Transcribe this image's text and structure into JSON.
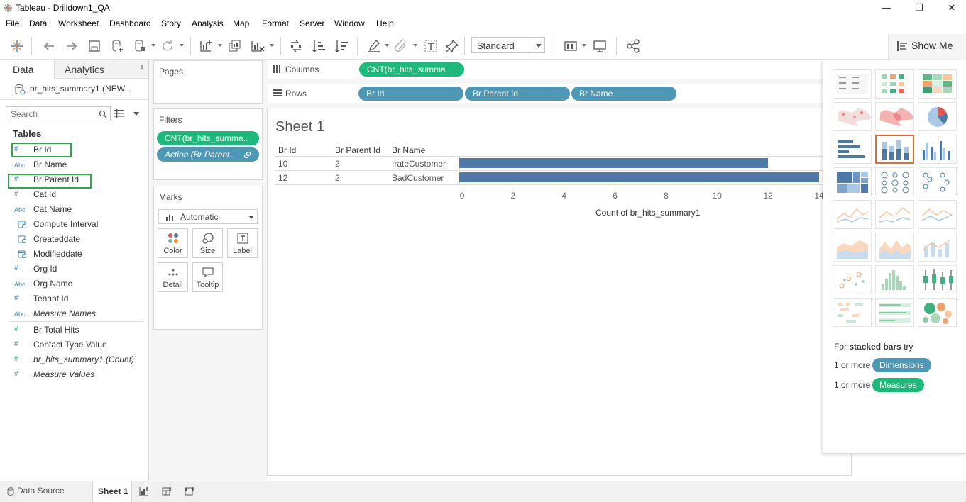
{
  "window": {
    "title": "Tableau - Drilldown1_QA",
    "controls": {
      "minimize": "—",
      "restore": "❐",
      "close": "✕"
    }
  },
  "menu": [
    "File",
    "Data",
    "Worksheet",
    "Dashboard",
    "Story",
    "Analysis",
    "Map",
    "Format",
    "Server",
    "Window",
    "Help"
  ],
  "toolbar": {
    "fit_select": "Standard",
    "show_me_label": "Show Me",
    "icons": [
      "tableau-logo-icon",
      "undo-icon",
      "redo-icon",
      "save-icon",
      "new-datasource-icon",
      "pause-updates-icon",
      "refresh-icon",
      "new-worksheet-icon",
      "duplicate-sheet-icon",
      "clear-sheet-icon",
      "swap-rows-columns-icon",
      "sort-ascending-icon",
      "sort-descending-icon",
      "highlight-icon",
      "group-icon",
      "show-labels-icon",
      "pin-icon",
      "show-cards-icon",
      "presentation-icon",
      "share-icon"
    ]
  },
  "left_pane": {
    "tabs": [
      "Data",
      "Analytics"
    ],
    "active_tab": "Data",
    "datasource": "br_hits_summary1 (NEW...",
    "search_placeholder": "Search",
    "tables_heading": "Tables",
    "dimensions": [
      {
        "type": "#",
        "name": "Br Id",
        "kind": "dim",
        "highlighted": true
      },
      {
        "type": "Abc",
        "name": "Br Name",
        "kind": "dim"
      },
      {
        "type": "#",
        "name": "Br Parent Id",
        "kind": "dim",
        "highlighted": true
      },
      {
        "type": "#",
        "name": "Cat Id",
        "kind": "dim"
      },
      {
        "type": "Abc",
        "name": "Cat Name",
        "kind": "dim"
      },
      {
        "type": "cal",
        "name": "Compute Interval",
        "kind": "dim"
      },
      {
        "type": "cal",
        "name": "Createddate",
        "kind": "dim"
      },
      {
        "type": "cal",
        "name": "Modifieddate",
        "kind": "dim"
      },
      {
        "type": "#",
        "name": "Org Id",
        "kind": "dim"
      },
      {
        "type": "Abc",
        "name": "Org Name",
        "kind": "dim"
      },
      {
        "type": "#",
        "name": "Tenant Id",
        "kind": "dim"
      },
      {
        "type": "Abc",
        "name": "Measure Names",
        "kind": "dim",
        "italic": true
      }
    ],
    "measures": [
      {
        "type": "#",
        "name": "Br Total Hits"
      },
      {
        "type": "#",
        "name": "Contact Type Value"
      },
      {
        "type": "#",
        "name": "br_hits_summary1 (Count)",
        "italic": true
      },
      {
        "type": "#",
        "name": "Measure Values",
        "italic": true
      }
    ]
  },
  "cards": {
    "pages_title": "Pages",
    "filters_title": "Filters",
    "filters": [
      "CNT(br_hits_summa..",
      "Action (Br Parent.."
    ],
    "marks_title": "Marks",
    "mark_type": "Automatic",
    "mark_buttons": [
      "Color",
      "Size",
      "Label",
      "Detail",
      "Tooltip"
    ]
  },
  "shelves": {
    "columns_label": "Columns",
    "columns": [
      "CNT(br_hits_summa.."
    ],
    "rows_label": "Rows",
    "rows": [
      "Br Id",
      "Br Parent Id",
      "Br Name"
    ]
  },
  "sheet": {
    "title": "Sheet 1",
    "headers": [
      "Br Id",
      "Br Parent Id",
      "Br Name"
    ],
    "axis_title": "Count of br_hits_summary1"
  },
  "chart_data": {
    "type": "bar",
    "orientation": "horizontal",
    "title": "",
    "row_headers": [
      "Br Id",
      "Br Parent Id",
      "Br Name"
    ],
    "rows": [
      {
        "br_id": "10",
        "br_parent_id": "2",
        "br_name": "IrateCustomer",
        "value": 12
      },
      {
        "br_id": "12",
        "br_parent_id": "2",
        "br_name": "BadCustomer",
        "value": 14
      }
    ],
    "xlabel": "Count of br_hits_summary1",
    "xticks": [
      "0",
      "2",
      "4",
      "6",
      "8",
      "10",
      "12",
      "14"
    ],
    "xlim": [
      0,
      14
    ],
    "bar_color": "#4e79a7"
  },
  "show_me": {
    "hint_prefix": "For ",
    "hint_bold": "stacked bars",
    "hint_suffix": " try",
    "dim_prefix": "1 or more",
    "dim_label": "Dimensions",
    "meas_prefix": "1 or more",
    "meas_label": "Measures",
    "thumbnails": [
      "text-table",
      "heat-map",
      "highlight-table",
      "symbol-map",
      "filled-map",
      "pie-chart",
      "horizontal-bars",
      "stacked-bars",
      "side-by-side-bars",
      "treemap",
      "circle-views",
      "side-by-side-circles",
      "lines-continuous",
      "lines-discrete",
      "dual-lines",
      "area-continuous",
      "area-discrete",
      "dual-combination",
      "scatter-plot",
      "histogram",
      "box-and-whisker",
      "gantt-chart",
      "bullet-graph",
      "packed-bubbles"
    ],
    "selected": "stacked-bars"
  },
  "bottom": {
    "datasource_tab": "Data Source",
    "sheet_tab": "Sheet 1"
  },
  "colors": {
    "dimension_pill": "#4f98b5",
    "measure_pill": "#1db97a",
    "highlight_box": "#2fa84b",
    "selected_thumb": "#e06b35"
  }
}
